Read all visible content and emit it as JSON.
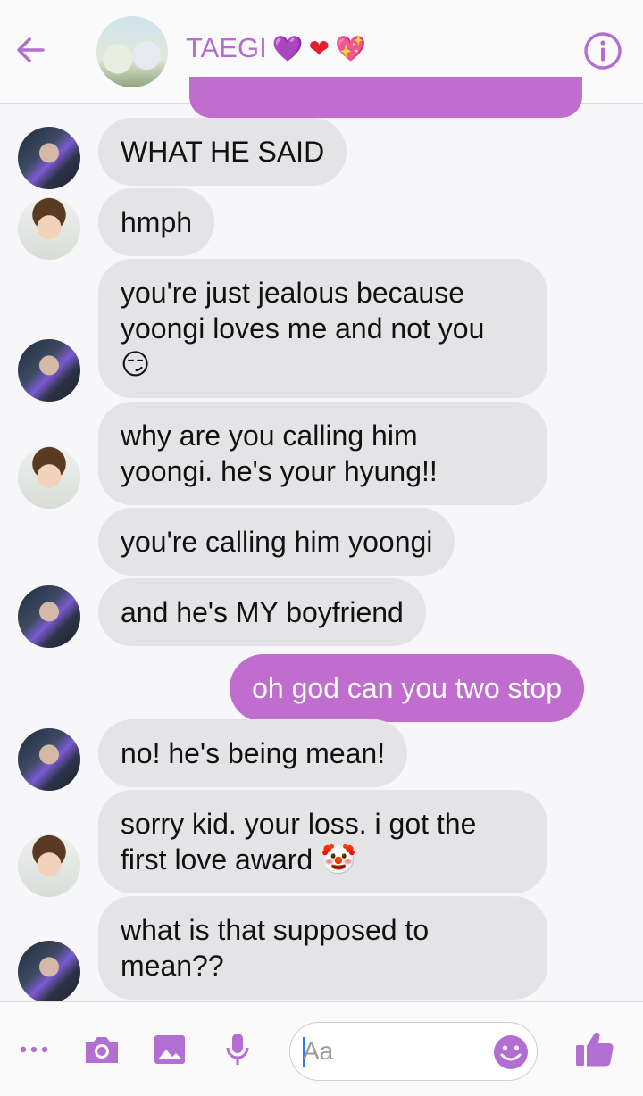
{
  "header": {
    "title": "TAEGI",
    "title_emojis": [
      "💜",
      "❤",
      "💖"
    ]
  },
  "colors": {
    "accent": "#b36ed1",
    "outgoing_bubble": "#c16ccf",
    "incoming_bubble": "#e4e4e6"
  },
  "messages": [
    {
      "sender": "tae",
      "text": "WHAT HE SAID"
    },
    {
      "sender": "jin",
      "text": "hmph"
    },
    {
      "sender": "tae",
      "text": "you're just jealous because\nyoongi loves me and not you\n😏"
    },
    {
      "sender": "jin",
      "text": "why are you calling him\nyoongi. he's your hyung!!"
    },
    {
      "sender": "tae",
      "text": "you're calling him yoongi"
    },
    {
      "sender": "tae",
      "text": "and he's MY boyfriend"
    },
    {
      "sender": "me",
      "text": "oh god can you two stop"
    },
    {
      "sender": "tae",
      "text": "no! he's being mean!"
    },
    {
      "sender": "jin",
      "text": "sorry kid. your loss. i got the\nfirst love award 🤡"
    },
    {
      "sender": "tae",
      "text": "what is that supposed to\nmean??"
    }
  ],
  "composer": {
    "placeholder": "Aa",
    "icons": [
      "more-icon",
      "camera-icon",
      "gallery-icon",
      "mic-icon",
      "emoji-icon",
      "like-icon"
    ]
  }
}
